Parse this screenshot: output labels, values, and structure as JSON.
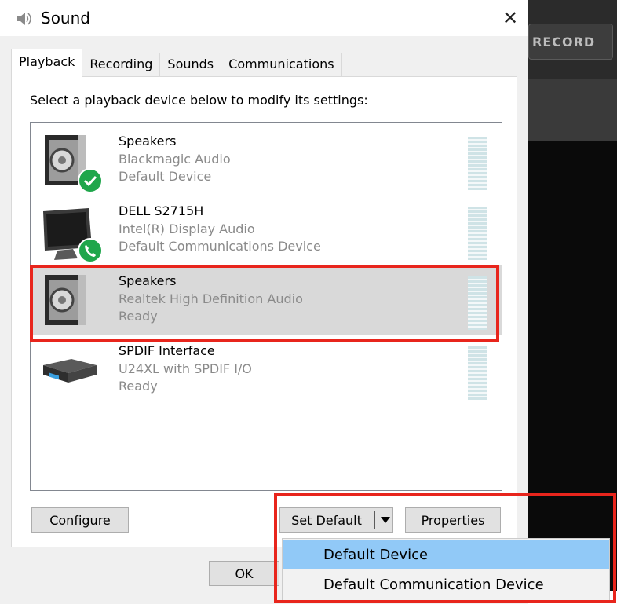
{
  "window": {
    "title": "Sound",
    "close_glyph": "✕"
  },
  "tabs": [
    "Playback",
    "Recording",
    "Sounds",
    "Communications"
  ],
  "active_tab": "Playback",
  "instruction": "Select a playback device below to modify its settings:",
  "devices": [
    {
      "name": "Speakers",
      "driver": "Blackmagic Audio",
      "status": "Default Device",
      "icon": "speaker-icon",
      "badge": "checkmark-badge-icon",
      "selected": false
    },
    {
      "name": "DELL S2715H",
      "driver": "Intel(R) Display Audio",
      "status": "Default Communications Device",
      "icon": "monitor-icon",
      "badge": "phone-badge-icon",
      "selected": false
    },
    {
      "name": "Speakers",
      "driver": "Realtek High Definition Audio",
      "status": "Ready",
      "icon": "speaker-icon",
      "badge": "",
      "selected": true
    },
    {
      "name": "SPDIF Interface",
      "driver": "U24XL with SPDIF I/O",
      "status": "Ready",
      "icon": "audio-interface-icon",
      "badge": "",
      "selected": false
    }
  ],
  "buttons": {
    "configure": "Configure",
    "set_default": "Set Default",
    "properties": "Properties",
    "ok": "OK"
  },
  "dropdown": {
    "items": [
      "Default Device",
      "Default Communication Device"
    ],
    "hovered": "Default Device"
  },
  "background_app": {
    "record_label": "RECORD"
  },
  "colors": {
    "highlight": "#e8251c",
    "menu_hover": "#91c9f7",
    "selected_row": "#d9d9d9",
    "badge_green": "#1fa64b"
  }
}
